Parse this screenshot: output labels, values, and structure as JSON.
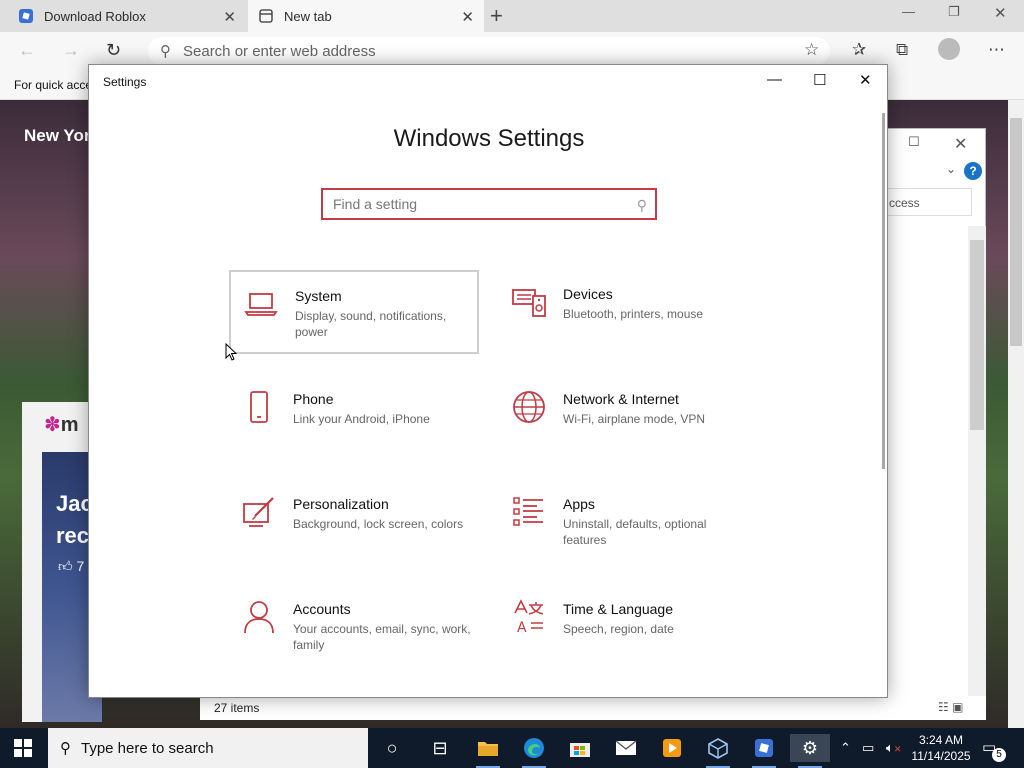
{
  "browser": {
    "tabs": [
      {
        "title": "Download Roblox"
      },
      {
        "title": "New tab"
      }
    ],
    "address_placeholder": "Search or enter web address",
    "favorites_bar_text": "For quick acce"
  },
  "background_page": {
    "logo_text": "New York",
    "card_logo": "m",
    "card_text_1": "Jac",
    "card_text_2": "rec",
    "card_likes": "7"
  },
  "explorer": {
    "search_partial": "ccess",
    "status_items": "27 items"
  },
  "settings": {
    "window_title": "Settings",
    "heading": "Windows Settings",
    "search_placeholder": "Find a setting",
    "accent_color": "#c33b44",
    "categories": [
      {
        "name": "System",
        "desc": "Display, sound, notifications, power",
        "icon": "laptop-icon"
      },
      {
        "name": "Devices",
        "desc": "Bluetooth, printers, mouse",
        "icon": "keyboard-speaker-icon"
      },
      {
        "name": "Phone",
        "desc": "Link your Android, iPhone",
        "icon": "phone-icon"
      },
      {
        "name": "Network & Internet",
        "desc": "Wi-Fi, airplane mode, VPN",
        "icon": "globe-icon"
      },
      {
        "name": "Personalization",
        "desc": "Background, lock screen, colors",
        "icon": "paint-icon"
      },
      {
        "name": "Apps",
        "desc": "Uninstall, defaults, optional features",
        "icon": "apps-list-icon"
      },
      {
        "name": "Accounts",
        "desc": "Your accounts, email, sync, work, family",
        "icon": "person-icon"
      },
      {
        "name": "Time & Language",
        "desc": "Speech, region, date",
        "icon": "time-language-icon"
      }
    ]
  },
  "taskbar": {
    "search_placeholder": "Type here to search",
    "time": "3:24 AM",
    "date": "11/14/2025",
    "notification_count": "5"
  }
}
